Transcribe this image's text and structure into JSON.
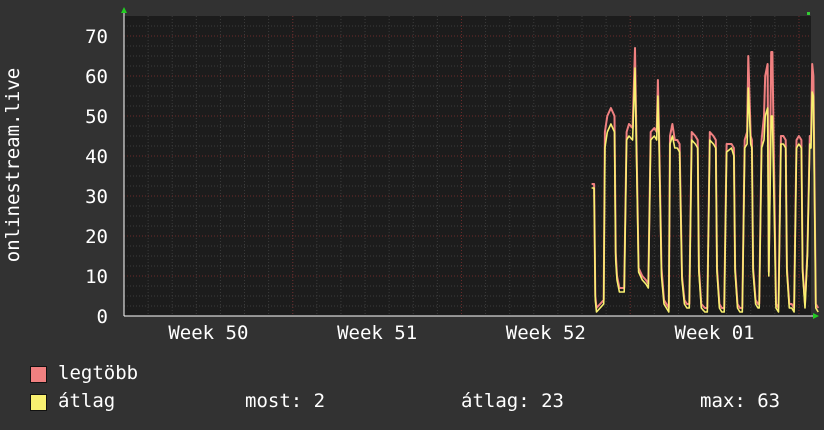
{
  "chart_data": {
    "type": "line",
    "title": "",
    "ylabel": "onlinestream.live",
    "xlabel": "",
    "ylim": [
      0,
      75
    ],
    "yticks": [
      0,
      10,
      20,
      30,
      40,
      50,
      60,
      70
    ],
    "xticks": [
      "Week 50",
      "Week 51",
      "Week 52",
      "Week 01"
    ],
    "grid": true,
    "legend_position": "bottom-left",
    "colors": {
      "background": "#323232",
      "plot": "#1c1c1c",
      "grid_minor": "#3c3c3c",
      "grid_major": "#6b2a2a",
      "legtobb": "#f08080",
      "atlag": "#f8f070"
    },
    "x_range": [
      0,
      28.5
    ],
    "series": [
      {
        "name": "legtöbb",
        "color": "#f08080",
        "points": [
          [
            19.4,
            33
          ],
          [
            19.5,
            33
          ],
          [
            19.55,
            5
          ],
          [
            19.6,
            2
          ],
          [
            19.75,
            3
          ],
          [
            19.9,
            4
          ],
          [
            19.95,
            46
          ],
          [
            20.05,
            50
          ],
          [
            20.2,
            52
          ],
          [
            20.35,
            50
          ],
          [
            20.4,
            16
          ],
          [
            20.45,
            10
          ],
          [
            20.55,
            7
          ],
          [
            20.75,
            7
          ],
          [
            20.85,
            46
          ],
          [
            20.95,
            48
          ],
          [
            21.1,
            47
          ],
          [
            21.2,
            67
          ],
          [
            21.25,
            48
          ],
          [
            21.35,
            12
          ],
          [
            21.5,
            10
          ],
          [
            21.65,
            9
          ],
          [
            21.75,
            8
          ],
          [
            21.85,
            46
          ],
          [
            22.0,
            47
          ],
          [
            22.1,
            46
          ],
          [
            22.15,
            59
          ],
          [
            22.2,
            45
          ],
          [
            22.3,
            12
          ],
          [
            22.4,
            4
          ],
          [
            22.5,
            3
          ],
          [
            22.6,
            2
          ],
          [
            22.65,
            45
          ],
          [
            22.75,
            48
          ],
          [
            22.85,
            44
          ],
          [
            22.95,
            44
          ],
          [
            23.05,
            43
          ],
          [
            23.15,
            10
          ],
          [
            23.25,
            4
          ],
          [
            23.35,
            3
          ],
          [
            23.45,
            3
          ],
          [
            23.55,
            46
          ],
          [
            23.7,
            45
          ],
          [
            23.8,
            44
          ],
          [
            23.85,
            12
          ],
          [
            23.95,
            3
          ],
          [
            24.1,
            2
          ],
          [
            24.2,
            2
          ],
          [
            24.3,
            46
          ],
          [
            24.45,
            45
          ],
          [
            24.55,
            44
          ],
          [
            24.6,
            12
          ],
          [
            24.7,
            3
          ],
          [
            24.8,
            2
          ],
          [
            24.9,
            2
          ],
          [
            25.0,
            43
          ],
          [
            25.2,
            43
          ],
          [
            25.3,
            42
          ],
          [
            25.35,
            12
          ],
          [
            25.45,
            3
          ],
          [
            25.55,
            2
          ],
          [
            25.65,
            2
          ],
          [
            25.75,
            44
          ],
          [
            25.85,
            46
          ],
          [
            25.9,
            65
          ],
          [
            26.0,
            45
          ],
          [
            26.05,
            44
          ],
          [
            26.1,
            12
          ],
          [
            26.2,
            4
          ],
          [
            26.3,
            3
          ],
          [
            26.35,
            3
          ],
          [
            26.45,
            44
          ],
          [
            26.55,
            50
          ],
          [
            26.6,
            60
          ],
          [
            26.7,
            63
          ],
          [
            26.75,
            11
          ],
          [
            26.85,
            66
          ],
          [
            26.9,
            66
          ],
          [
            27.05,
            3
          ],
          [
            27.15,
            2
          ],
          [
            27.25,
            45
          ],
          [
            27.35,
            45
          ],
          [
            27.45,
            44
          ],
          [
            27.5,
            12
          ],
          [
            27.6,
            3
          ],
          [
            27.7,
            3
          ],
          [
            27.8,
            2
          ],
          [
            27.9,
            44
          ],
          [
            28.0,
            45
          ],
          [
            28.1,
            44
          ],
          [
            28.15,
            12
          ],
          [
            28.25,
            3
          ],
          [
            28.35,
            16
          ],
          [
            28.45,
            45
          ],
          [
            28.5,
            44
          ],
          [
            28.55,
            63
          ],
          [
            28.6,
            60
          ],
          [
            28.7,
            3
          ],
          [
            28.8,
            2
          ]
        ]
      },
      {
        "name": "átlag",
        "color": "#f8f070",
        "points": [
          [
            19.4,
            32
          ],
          [
            19.5,
            32
          ],
          [
            19.55,
            4
          ],
          [
            19.6,
            1
          ],
          [
            19.75,
            2
          ],
          [
            19.9,
            3
          ],
          [
            19.95,
            42
          ],
          [
            20.05,
            46
          ],
          [
            20.2,
            48
          ],
          [
            20.35,
            46
          ],
          [
            20.4,
            14
          ],
          [
            20.45,
            9
          ],
          [
            20.55,
            6
          ],
          [
            20.75,
            6
          ],
          [
            20.85,
            44
          ],
          [
            20.95,
            45
          ],
          [
            21.1,
            44
          ],
          [
            21.2,
            62
          ],
          [
            21.25,
            44
          ],
          [
            21.35,
            11
          ],
          [
            21.5,
            9
          ],
          [
            21.65,
            8
          ],
          [
            21.75,
            7
          ],
          [
            21.85,
            44
          ],
          [
            22.0,
            45
          ],
          [
            22.1,
            44
          ],
          [
            22.15,
            55
          ],
          [
            22.2,
            43
          ],
          [
            22.3,
            10
          ],
          [
            22.4,
            3
          ],
          [
            22.5,
            2
          ],
          [
            22.6,
            1
          ],
          [
            22.65,
            43
          ],
          [
            22.75,
            45
          ],
          [
            22.85,
            42
          ],
          [
            22.95,
            42
          ],
          [
            23.05,
            41
          ],
          [
            23.15,
            9
          ],
          [
            23.25,
            3
          ],
          [
            23.35,
            2
          ],
          [
            23.45,
            2
          ],
          [
            23.55,
            44
          ],
          [
            23.7,
            43
          ],
          [
            23.8,
            42
          ],
          [
            23.85,
            11
          ],
          [
            23.95,
            2
          ],
          [
            24.1,
            1
          ],
          [
            24.2,
            1
          ],
          [
            24.3,
            44
          ],
          [
            24.45,
            43
          ],
          [
            24.55,
            42
          ],
          [
            24.6,
            11
          ],
          [
            24.7,
            2
          ],
          [
            24.8,
            1
          ],
          [
            24.9,
            1
          ],
          [
            25.0,
            41
          ],
          [
            25.2,
            42
          ],
          [
            25.3,
            40
          ],
          [
            25.35,
            11
          ],
          [
            25.45,
            2
          ],
          [
            25.55,
            1
          ],
          [
            25.65,
            1
          ],
          [
            25.75,
            42
          ],
          [
            25.85,
            43
          ],
          [
            25.9,
            57
          ],
          [
            26.0,
            43
          ],
          [
            26.05,
            42
          ],
          [
            26.1,
            11
          ],
          [
            26.2,
            3
          ],
          [
            26.3,
            2
          ],
          [
            26.35,
            2
          ],
          [
            26.45,
            42
          ],
          [
            26.55,
            44
          ],
          [
            26.6,
            50
          ],
          [
            26.7,
            52
          ],
          [
            26.75,
            10
          ],
          [
            26.85,
            50
          ],
          [
            26.9,
            50
          ],
          [
            27.05,
            2
          ],
          [
            27.15,
            1
          ],
          [
            27.25,
            43
          ],
          [
            27.35,
            43
          ],
          [
            27.45,
            42
          ],
          [
            27.5,
            11
          ],
          [
            27.6,
            2
          ],
          [
            27.7,
            2
          ],
          [
            27.8,
            1
          ],
          [
            27.9,
            42
          ],
          [
            28.0,
            43
          ],
          [
            28.1,
            42
          ],
          [
            28.15,
            11
          ],
          [
            28.25,
            2
          ],
          [
            28.35,
            15
          ],
          [
            28.45,
            43
          ],
          [
            28.5,
            42
          ],
          [
            28.55,
            56
          ],
          [
            28.6,
            55
          ],
          [
            28.7,
            2
          ],
          [
            28.8,
            1
          ]
        ]
      }
    ]
  },
  "legend": {
    "items": [
      {
        "label": "legtöbb",
        "color": "#f08080"
      },
      {
        "label": "átlag",
        "color": "#f8f070"
      }
    ],
    "now": "most: 2",
    "avg": "átlag: 23",
    "max": "max: 63"
  }
}
